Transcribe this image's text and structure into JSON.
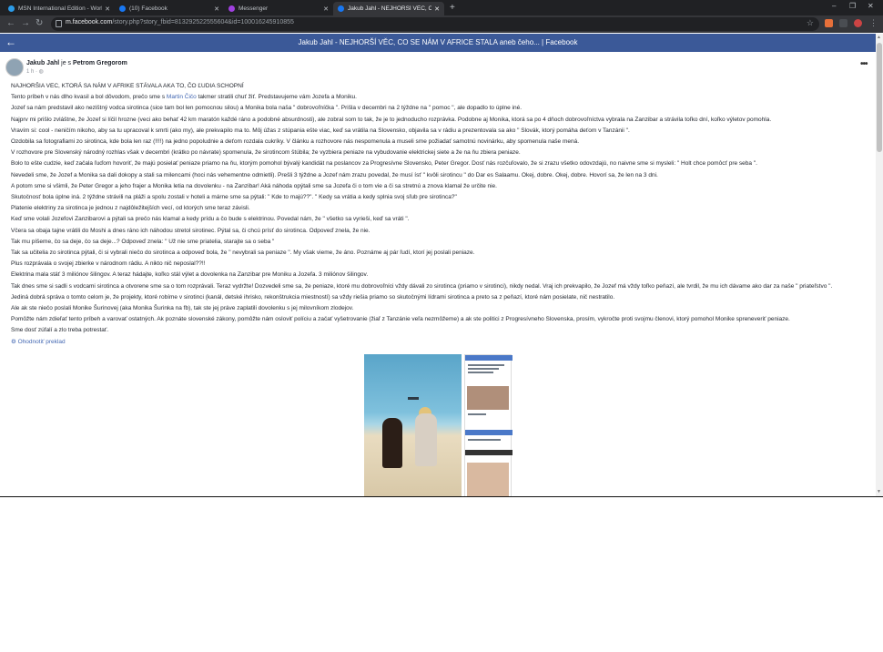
{
  "browser": {
    "tabs": [
      {
        "title": "MSN International Edition - World",
        "favicon_color": "#2b9be8"
      },
      {
        "title": "(10) Facebook",
        "favicon_color": "#1877f2"
      },
      {
        "title": "Messenger",
        "favicon_color": "#a040e0"
      },
      {
        "title": "Jakub Jahl - NEJHORŠÍ VĚC, CO SE NÁM",
        "favicon_color": "#1877f2"
      }
    ],
    "url_host": "m.facebook.com",
    "url_path": "/story.php?story_fbid=813292522555604&id=100016245910855"
  },
  "page": {
    "title": "Jakub Jahl - NEJHORŠÍ VĚC, CO SE NÁM V AFRICE STALA aneb čeho... | Facebook",
    "accent": "#3b5998"
  },
  "post": {
    "author": "Jakub Jahl",
    "with_text": "je s",
    "tagged": "Petrom Gregorom",
    "time": "1 h",
    "lines": [
      "NAJHORŠIA VEC, KTORÁ SA NÁM V AFRIKE STÁVALA AKA TO, ČO ĽUDIA SCHOPNÍ",
      "Tento príbeh v nás dlho kvasil a bol dôvodom, prečo sme s",
      "Jozef sa nám predstavil ako nezištný vodca sirotinca (sice tam bol len pomocnou silou) a Monika bola naša \" dobrovoľníčka \". Prišla v decembri na 2 týždne na \" pomoc \", ale dopadlo to úplne iné.",
      "Najprv mi prišlo zvláštne, že Jozef si líčil hrozne (veci ako behať 42 km maratón každé ráno a podobné absurdnosti), ale zobral som to tak, že je to jednoducho rozprávka. Podobne aj Monika, ktorá sa po 4 dňoch dobrovoľníctva vybrala na Zanzibar a strávila toľko dní, koľko výletov pomohla.",
      "Vravím si: cool - neničím nikoho, aby sa tu upracoval k smrti (ako my), ale prekvapilo ma to. Môj úžas z stúpania ešte viac, keď sa vrátila na Slovensko, objavila sa v rádiu a prezentovala sa ako \" Slovák, ktorý pomáha deťom v Tanzánii \".",
      "Ozdobila sa fotografiami zo sirotinca, kde bola len raz (!!!!) na jedno popoludnie a deťom rozdala cukríky. V článku a rozhovore nás nespomenula a museli sme požiadať samotnú novinárku, aby spomenula naše mená.",
      "V rozhovore pre Slovenský národný rozhlas však v decembri (krátko po návrate) spomenula, že sirotincom štúbila; že vyzbiera peniaze na vybudovanie elektrickej siete a že na ňu zbiera peniaze.",
      "Bolo to ešte cudzie, keď začala ľuďom hovoriť, že majú posielať peniaze priamo na ňu, ktorým pomohol bývalý kandidát na poslancov za Progresívne Slovensko, Peter Gregor. Dosť nás rozčuľovalo, že si zrazu všetko odovzdajú, no naivne sme si mysleli: \" Holt chce pomôcť pre seba \".",
      "Nevedeli sme, že Jozef a Monika sa dali dokopy a stali sa milencami (hoci nás vehementne odmietli). Prešli 3 týždne a Jozef nám zrazu povedal, že musí ísť \" kvôli sirotincu \" do Dar es Salaamu. Okej, dobre. Okej, dobre. Hovorí sa, že len na 3 dni.",
      "A potom sme si všimli, že Peter Gregor a jeho frajer a Monika letia na dovolenku - na Zanzibar! Aká náhoda opýtali sme sa Jozefa či o tom vie a či sa stretnú a znova klamal že určite nie.",
      "Skutočnosť bola úplne iná. 2 týždne strávili na pláži a spolu zostali v hoteli a márne sme sa pýtali: \" Kde to majú??\". \" Kedy sa vrátia a kedy splnia svoj sľub pre sirotinca?\"",
      "Platenie elektriny za sirotinca je jednou z najdôležitejších vecí, od ktorých sme teraz závisli.",
      "Keď sme volali Jozefovi Zanzibarovi a pýtali sa prečo nás klamal a kedy prídu a čo bude s elektrinou. Povedal nám, že \" všetko sa vyrieši, keď sa vráti \".",
      "Včera sa obaja tajne vrátili do Moshi a dnes ráno ich náhodou stretol sirotinec. Pýtal sa, či chcú prísť do sirotinca. Odpoveď znela, že nie.",
      "Tak mu píšeme, čo sa deje, čo sa deje...? Odpoveď znela: \" Už nie sme priatelia, starajte sa o seba \"",
      "Tak sa učitelia zo sirotinca pýtali, či si vybrali niečo do sirotinca a odpoveď bola, že \" nevybrali sa peniaze \". My však vieme, že áno. Poznáme aj pár ľudí, ktorí jej poslali peniaze.",
      "Plus rozprávala o svojej zbierke v národnom rádiu. A nikto nič neposlal??!!",
      "Elektrina mala stáť 3 miliónov šilingov. A teraz hádajte, koľko stál výlet a dovolenka na Zanzibar pre Moniku a Jozefa. 3 miliónov šilingov.",
      "Tak dnes sme si sadli s vodcami sirotinca a otvorene sme sa o tom rozprávali. Teraz vydržte! Dozvedeli sme sa, že peniaze, ktoré mu dobrovoľníci vždy dávali zo sirotinca (priamo v sirotinci), nikdy nedal. Vraj ich prekvapilo, že Jozef má vždy toľko peňazí, ale tvrdil, že mu ich dávame ako dar za naše \" priateľstvo \".",
      "Jediná dobrá správa o tomto celom je, že projekty, ktoré robíme v sirotinci (kanál, detské ihrisko, rekonštrukcia miestností) sa vždy riešia priamo so skutočnými lídrami sirotinca a preto sa z peňazí, ktoré nám posielate, nič nestratilo.",
      "Ale ak ste niečo poslali Monike Šurinovej (aka Monika Šurinka na fb), tak ste jej práve zaplatili dovolenku s jej milovníkom zlodejov.",
      "Pomôžte nám zdieľať tento príbeh a varovať ostatných. Ak poznáte slovenské zákony, pomôžte nám osloviť políciu a začať vyšetrovanie (žiaľ z Tanzánie veľa nezmôžeme) a ak ste politici z Progresívneho Slovenska, prosím, vykročte proti svojmu členovi, ktorý pomohol Monike spreneveriť peniaze.",
      "Sme dosť zúfalí a zlo treba potrestať."
    ],
    "line2_link": "Martin Čičo",
    "line2_rest": "takmer stratili chuť žiť. Predstavujeme vám Jozefa a Moniku.",
    "rate_label": "Ohodnotiť preklad"
  }
}
